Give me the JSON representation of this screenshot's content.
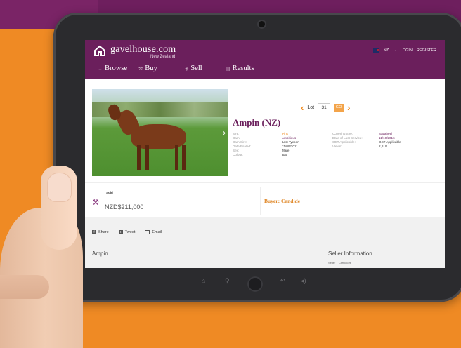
{
  "header": {
    "brand": "gavelhouse.com",
    "brand_sub": "New Zealand",
    "region": "NZ",
    "login": "LOGIN",
    "register": "REGISTER"
  },
  "nav": [
    {
      "label": "Browse"
    },
    {
      "label": "Buy"
    },
    {
      "label": "Sell"
    },
    {
      "label": "Results"
    }
  ],
  "lot": {
    "label": "Lot",
    "number": "31",
    "go": "GO"
  },
  "horse": {
    "name": "Ampin (NZ)",
    "details": [
      {
        "k1": "Sire:",
        "v1": "Pins",
        "k2": "Covering Sire:",
        "v2": "Savabeel"
      },
      {
        "k1": "Dam:",
        "v1": "Ambitious",
        "k2": "Date of Last Service:",
        "v2": "11/10/2016"
      },
      {
        "k1": "Dam Sire:",
        "v1": "Last Tycoon",
        "k2": "GST Applicable:",
        "v2": "GST Applicable"
      },
      {
        "k1": "Date Foaled:",
        "v1": "21/09/2011",
        "k2": "Views:",
        "v2": "2,619"
      },
      {
        "k1": "Sex:",
        "v1": "Mare",
        "k2": "",
        "v2": ""
      },
      {
        "k1": "Colour:",
        "v1": "Bay",
        "k2": "",
        "v2": ""
      }
    ]
  },
  "sale": {
    "status": "Sold",
    "price": "NZD$211,000",
    "buyer": "Buyer: Candide"
  },
  "share": {
    "facebook": "Share",
    "twitter": "Tweet",
    "email": "Email"
  },
  "section_title": "Ampin",
  "seller": {
    "title": "Seller Information",
    "label": "Seller",
    "value": "Carrickore"
  },
  "colors": {
    "brand_purple": "#6b1f5c",
    "accent_orange": "#f08a1e",
    "background_orange": "#ef8a24"
  }
}
